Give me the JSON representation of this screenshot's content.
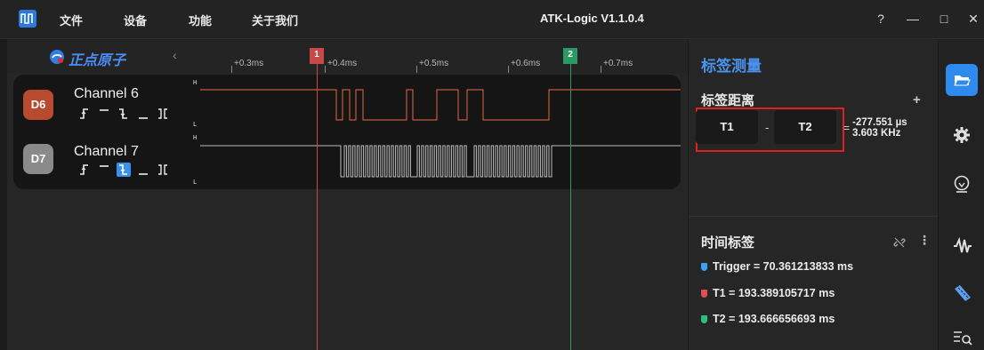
{
  "app": {
    "title": "ATK-Logic V1.1.0.4",
    "menu": [
      "文件",
      "设备",
      "功能",
      "关于我们"
    ],
    "window_buttons": [
      "?",
      "—",
      "□",
      "✕"
    ]
  },
  "brand": {
    "text": "正点原子"
  },
  "ruler": {
    "ticks": [
      "+0.3ms",
      "+0.4ms",
      "+0.5ms",
      "+0.6ms",
      "+0.7ms"
    ],
    "markers": [
      {
        "label": "1",
        "color": "#c84848"
      },
      {
        "label": "2",
        "color": "#2a9a64"
      }
    ]
  },
  "channels": [
    {
      "badge": "D6",
      "name": "Channel 6",
      "color": "#b84a2f",
      "high": "H",
      "low": "L",
      "active_trigger": null
    },
    {
      "badge": "D7",
      "name": "Channel 7",
      "color": "#8a8a8a",
      "high": "H",
      "low": "L",
      "active_trigger": 2
    }
  ],
  "measure": {
    "title": "标签测量",
    "distance_title": "标签距离",
    "add": "+",
    "from": "T1",
    "minus": "-",
    "to": "T2",
    "eq": "=",
    "time": "-277.551 µs",
    "freq": "3.603 KHz"
  },
  "time_tags": {
    "title": "时间标签",
    "items": [
      {
        "text": "Trigger = 70.361213833 ms",
        "color": "#3a9ff5"
      },
      {
        "text": "T1 = 193.389105717 ms",
        "color": "#e05050"
      },
      {
        "text": "T2 = 193.666656693 ms",
        "color": "#2abf7a"
      }
    ]
  },
  "toolbar": {
    "icons": [
      "folder-icon",
      "gear-icon",
      "device-icon",
      "waveform-icon",
      "ruler-icon",
      "search-list-icon"
    ]
  }
}
